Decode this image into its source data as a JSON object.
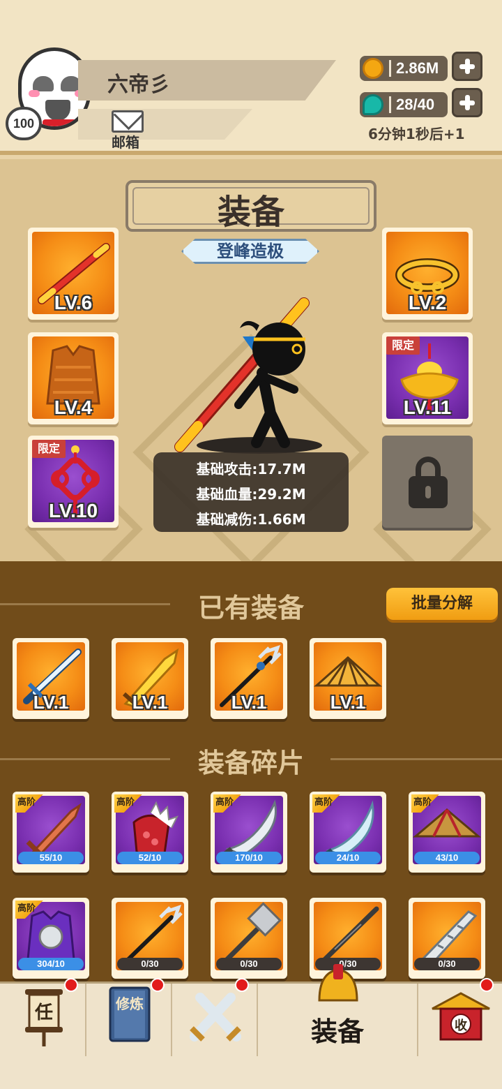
{
  "player": {
    "name": "六帝彡",
    "level": "100",
    "mail_label": "邮箱"
  },
  "resources": {
    "coins": "2.86M",
    "gems": "28/40",
    "timer": "6分钟1秒后+1"
  },
  "stage": {
    "title": "装备",
    "rank": "登峰造极",
    "left_slots": [
      {
        "level": "LV.6",
        "item": "staff",
        "color": "orange",
        "limited": false
      },
      {
        "level": "LV.4",
        "item": "armor",
        "color": "orange",
        "limited": false
      },
      {
        "level": "LV.10",
        "item": "chinese-knot",
        "color": "purple",
        "limited": true
      }
    ],
    "right_slots": [
      {
        "level": "LV.2",
        "item": "golden-headband",
        "color": "orange",
        "limited": false
      },
      {
        "level": "LV.11",
        "item": "gold-ingot",
        "color": "purple",
        "limited": true
      }
    ],
    "limited_label": "限定",
    "stats": [
      "基础攻击:17.7M",
      "基础血量:29.2M",
      "基础减伤:1.66M"
    ]
  },
  "owned": {
    "title": "已有装备",
    "batch_button": "批量分解",
    "items": [
      {
        "level": "LV.1",
        "item": "sword-icon"
      },
      {
        "level": "LV.1",
        "item": "golden-blade-icon"
      },
      {
        "level": "LV.1",
        "item": "trident-icon"
      },
      {
        "level": "LV.1",
        "item": "straw-hat-icon"
      }
    ]
  },
  "fragments": {
    "title": "装备碎片",
    "grade_label": "高阶",
    "items": [
      {
        "count": "55/10",
        "grade": true,
        "color": "purple",
        "item": "wooden-sword-icon"
      },
      {
        "count": "52/10",
        "grade": true,
        "color": "purple",
        "item": "red-gauntlet-icon"
      },
      {
        "count": "170/10",
        "grade": true,
        "color": "purple",
        "item": "broad-blade-icon"
      },
      {
        "count": "24/10",
        "grade": true,
        "color": "purple",
        "item": "curved-blade-icon"
      },
      {
        "count": "43/10",
        "grade": true,
        "color": "purple",
        "item": "red-hat-icon"
      },
      {
        "count": "304/10",
        "grade": true,
        "color": "purple",
        "item": "shield-armor-icon"
      },
      {
        "count": "0/30",
        "grade": false,
        "color": "orange",
        "item": "halberd-icon"
      },
      {
        "count": "0/30",
        "grade": false,
        "color": "orange",
        "item": "axe-icon"
      },
      {
        "count": "0/30",
        "grade": false,
        "color": "orange",
        "item": "staff-icon"
      },
      {
        "count": "0/30",
        "grade": false,
        "color": "orange",
        "item": "jagged-blade-icon"
      }
    ]
  },
  "nav": {
    "tabs": [
      {
        "id": "task",
        "icon": "任",
        "badge": true
      },
      {
        "id": "train",
        "icon": "修炼",
        "badge": true
      },
      {
        "id": "battle",
        "icon": "",
        "badge": true
      },
      {
        "id": "equip",
        "label": "装备",
        "badge": false,
        "active": true
      },
      {
        "id": "collect",
        "icon": "收",
        "badge": true
      }
    ]
  }
}
